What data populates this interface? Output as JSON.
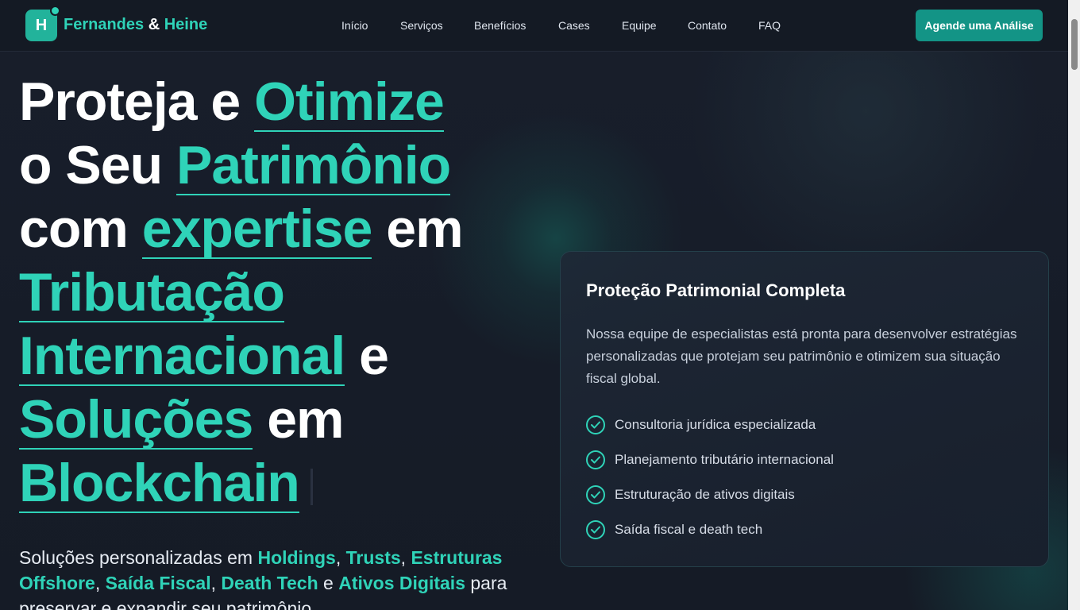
{
  "nav": {
    "logo_letter": "H",
    "brand_part1": "Fernandes",
    "brand_amp": "&",
    "brand_part2": "Heine",
    "menu": [
      "Início",
      "Serviços",
      "Benefícios",
      "Cases",
      "Equipe",
      "Contato",
      "FAQ"
    ],
    "cta_label": "Agende uma Análise"
  },
  "hero": {
    "line1": {
      "a": "Proteja e",
      "b": "Otimize"
    },
    "line2": {
      "a": "o Seu",
      "b": "Patrimônio"
    },
    "line3": {
      "a": "com",
      "b": "expertise",
      "c": "em"
    },
    "line4": {
      "b": "Tributação"
    },
    "line5": {
      "b": "Internacional",
      "c": "e"
    },
    "line6": {
      "b": "Soluções",
      "c": "em"
    },
    "line7": {
      "b": "Blockchain"
    }
  },
  "subtitle": {
    "p1": "Soluções personalizadas em",
    "k1": "Holdings",
    "s1": ",",
    "k2": "Trusts",
    "s2": ",",
    "k3": "Estruturas Offshore",
    "s3": ",",
    "k4": "Saída Fiscal",
    "s4": ",",
    "k5": "Death Tech",
    "s5": "e",
    "k6": "Ativos Digitais",
    "p2": "para preservar e expandir seu patrimônio"
  },
  "card": {
    "title": "Proteção Patrimonial Completa",
    "description": "Nossa equipe de especialistas está pronta para desenvolver estratégias personalizadas que protejam seu patrimônio e otimizem sua situação fiscal global.",
    "features": [
      "Consultoria jurídica especializada",
      "Planejamento tributário internacional",
      "Estruturação de ativos digitais",
      "Saída fiscal e death tech"
    ]
  },
  "colors": {
    "accent": "#2fd3b8",
    "button": "#139486",
    "background": "#161c28"
  },
  "icons": {
    "feature_bullet": "check-circle-icon"
  }
}
